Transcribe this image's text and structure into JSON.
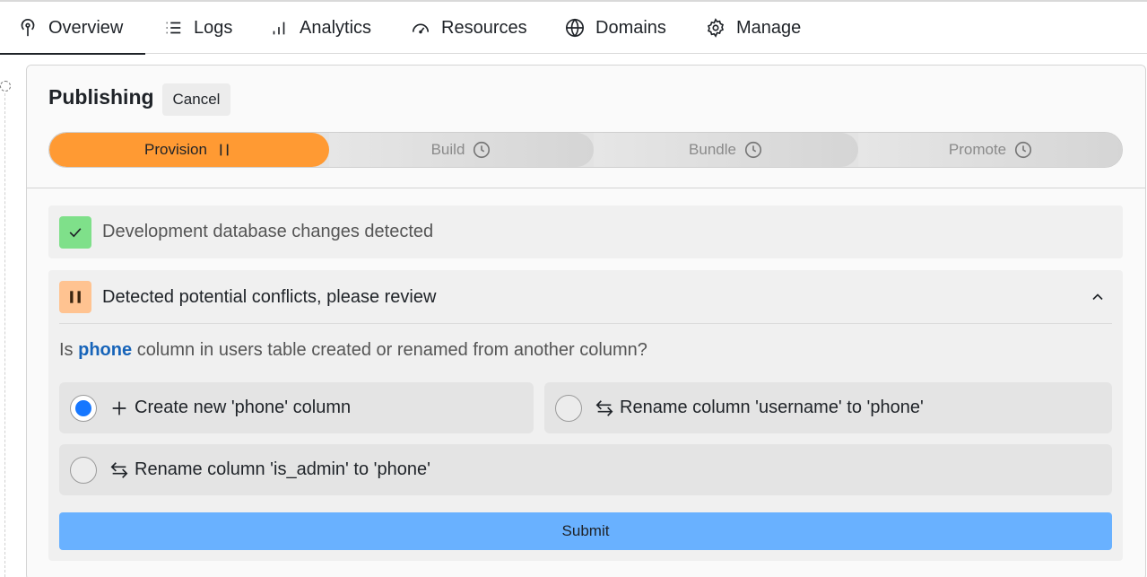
{
  "nav": {
    "tabs": [
      {
        "label": "Overview",
        "icon": "antenna-icon",
        "active": true
      },
      {
        "label": "Logs",
        "icon": "list-icon"
      },
      {
        "label": "Analytics",
        "icon": "bar-chart-icon"
      },
      {
        "label": "Resources",
        "icon": "gauge-icon"
      },
      {
        "label": "Domains",
        "icon": "globe-icon"
      },
      {
        "label": "Manage",
        "icon": "gear-icon"
      }
    ]
  },
  "card": {
    "title": "Publishing",
    "cancel_label": "Cancel",
    "steps": [
      {
        "label": "Provision",
        "status": "paused",
        "icon": "pause-icon"
      },
      {
        "label": "Build",
        "status": "pending",
        "icon": "clock-icon"
      },
      {
        "label": "Bundle",
        "status": "pending",
        "icon": "clock-icon"
      },
      {
        "label": "Promote",
        "status": "pending",
        "icon": "clock-icon"
      }
    ],
    "detected": {
      "text": "Development database changes detected",
      "icon": "check-icon"
    },
    "conflict": {
      "text": "Detected potential conflicts, please review",
      "icon": "pause-icon",
      "question_prefix": "Is",
      "question_highlight": "phone",
      "question_suffix": "column in users table created or renamed from another column?",
      "options": [
        {
          "label": "Create new 'phone' column",
          "icon": "plus-icon",
          "selected": true
        },
        {
          "label": "Rename column 'username' to 'phone'",
          "icon": "swap-icon",
          "selected": false
        },
        {
          "label": "Rename column 'is_admin' to 'phone'",
          "icon": "swap-icon",
          "selected": false
        }
      ],
      "submit_label": "Submit"
    }
  },
  "colors": {
    "active_step": "#ff9a33",
    "success": "#7fe08a",
    "warning": "#ffc391",
    "submit": "#69b1ff",
    "radio_selected": "#1677ff",
    "highlight": "#1764b9"
  }
}
